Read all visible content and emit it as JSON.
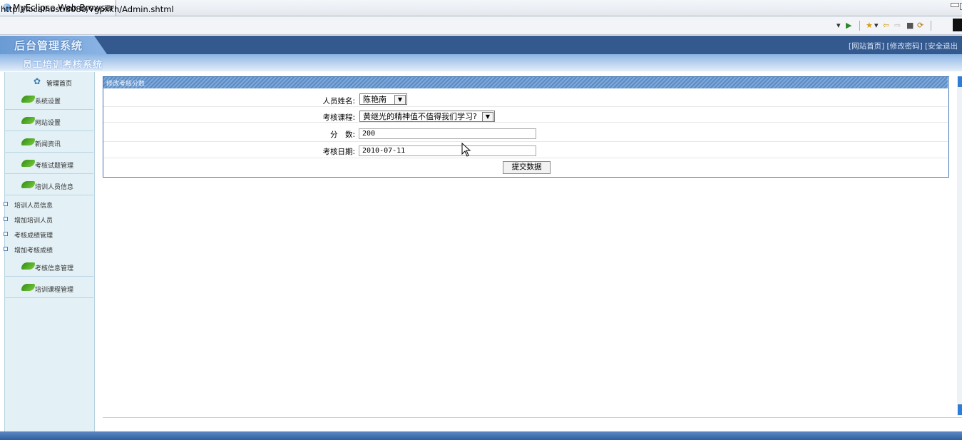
{
  "browser": {
    "tab_title": "MyEclipse Web Browser",
    "tab_close": "⊠",
    "url": "http://localhost:8080/Ygpxkh/Admin.shtml",
    "toolbar": {
      "dropdown": "▾",
      "go": "▶",
      "favorites": "★",
      "favorites_drop": "▾",
      "back": "⇦",
      "forward": "⇨",
      "stop": "■",
      "refresh": "⟳"
    }
  },
  "header": {
    "title": "后台管理系统",
    "links": "[网站首页] [修改密码] [安全退出",
    "subtitle": "员工培训考核系统"
  },
  "sidebar": {
    "home_label": "管理首页",
    "home_icon": "home-icon",
    "menus_top": [
      "系统设置",
      "网站设置",
      "新闻资讯",
      "考核试题管理",
      "培训人员信息"
    ],
    "submenu": [
      "培训人员信息",
      "增加培训人员",
      "考核成绩管理",
      "增加考核成绩"
    ],
    "menus_bottom": [
      "考核信息管理",
      "培训课程管理"
    ]
  },
  "panel": {
    "title": "修改考核分数",
    "fields": {
      "name_label": "人员姓名:",
      "name_value": "陈艳南",
      "course_label": "考核课程:",
      "course_value": "黄继光的精神值不值得我们学习?",
      "score_label": "分　数:",
      "score_value": "200",
      "date_label": "考核日期:",
      "date_value": "2010-07-11"
    },
    "submit_label": "提交数据"
  },
  "colors": {
    "header_bg": "#34598f",
    "sidebar_bg": "#e3f1f6",
    "panel_border": "#3e74b3",
    "scroll_accent": "#2d7cd8"
  }
}
